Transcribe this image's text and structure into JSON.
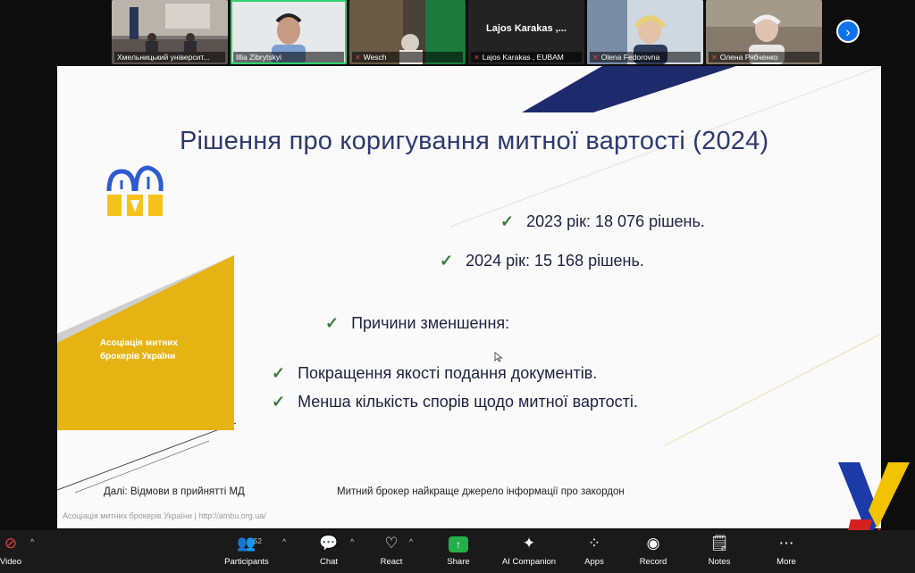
{
  "participants": [
    {
      "name": "Хмельницький університ...",
      "muted": false
    },
    {
      "name": "Illia Zibrytskyi",
      "muted": false
    },
    {
      "name": "Wesch",
      "muted": true
    },
    {
      "name": "Lajos Karakas , EUBAM",
      "display": "Lajos Karakas ,...",
      "muted": true
    },
    {
      "name": "Olena Fedorovna",
      "muted": true
    },
    {
      "name": "Олена Рябченко",
      "muted": true
    }
  ],
  "next_icon": "chevron-right-icon",
  "slide": {
    "title": "Рішення про коригування митної вартості (2024)",
    "bullets": [
      "2023 рік: 18 076 рішень.",
      "2024 рік: 15 168 рішень.",
      "Причини зменшення:",
      "Покращення якості подання документів.",
      "Менша кількість спорів щодо митної вартості."
    ],
    "org_name_line1": "Асоціація митних",
    "org_name_line2": "брокерів України",
    "footer_next": "Далі: Відмови в прийнятті МД",
    "footer_slogan": "Митний брокер найкраще джерело інформації про закордон",
    "footer_site": "Асоціація митних брокерів України | http://ambu.org.ua/",
    "accent_gold": "#e5b312",
    "accent_navy": "#1d2a6b",
    "title_color": "#2e3a6e"
  },
  "toolbar": {
    "video": "Video",
    "participants": "Participants",
    "participants_count": "52",
    "chat": "Chat",
    "react": "React",
    "share": "Share",
    "ai_companion": "AI Companion",
    "apps": "Apps",
    "record": "Record",
    "notes": "Notes",
    "more": "More"
  }
}
